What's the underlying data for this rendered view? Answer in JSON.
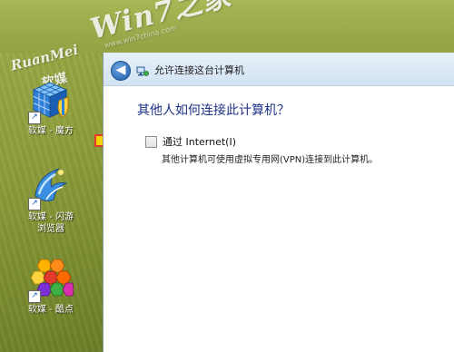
{
  "watermark": {
    "brand_en": "RuanMei",
    "brand_cn": "软媒",
    "site": "Win7之家",
    "url": "www.win7china.com"
  },
  "desktop_icons": [
    {
      "label": "软媒 - 魔方",
      "icon": "rubik-cube-shield-icon"
    },
    {
      "label_line1": "软媒 - 闪游",
      "label_line2": "浏览器",
      "icon": "blue-swoosh-browser-icon"
    },
    {
      "label": "软媒 - 酷点",
      "icon": "hexagon-cluster-icon"
    }
  ],
  "dialog": {
    "title": "允许连接这台计算机",
    "question": "其他人如何连接此计算机？",
    "option_label": "通过 Internet(I)",
    "option_checked": false,
    "option_desc": "其他计算机可使用虚拟专用网(VPN)连接到此计算机。"
  },
  "colors": {
    "question_text": "#1e3287",
    "arrow_fill": "#f5d400",
    "arrow_stroke": "#e23b2b"
  }
}
